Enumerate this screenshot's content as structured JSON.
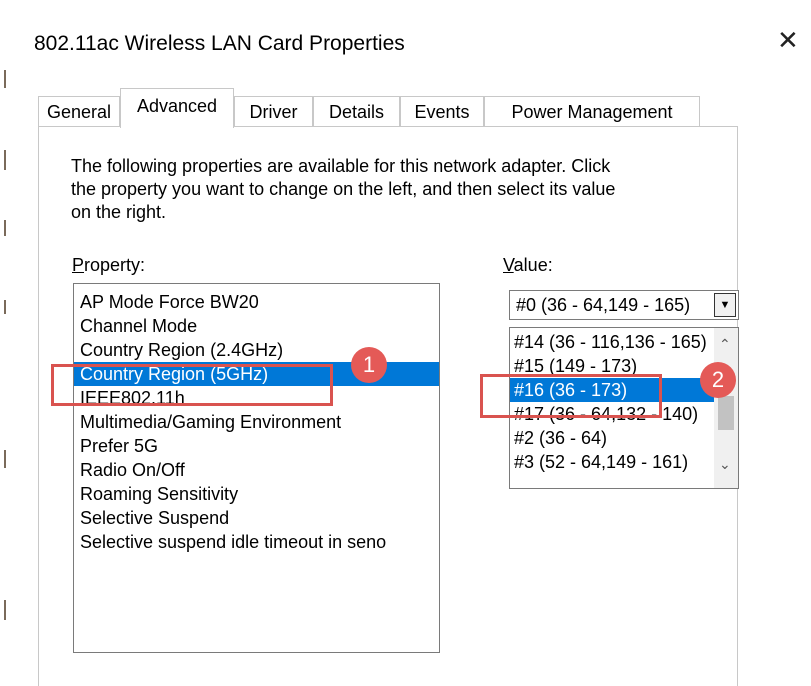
{
  "window": {
    "title": "802.11ac Wireless LAN Card Properties",
    "close_glyph": "✕"
  },
  "tabs": [
    {
      "label": "General",
      "active": false
    },
    {
      "label": "Advanced",
      "active": true
    },
    {
      "label": "Driver",
      "active": false
    },
    {
      "label": "Details",
      "active": false
    },
    {
      "label": "Events",
      "active": false
    },
    {
      "label": "Power Management",
      "active": false
    }
  ],
  "description": {
    "line1": "The following properties are available for this network adapter. Click",
    "line2": "the property you want to change on the left, and then select its value",
    "line3": "on the right."
  },
  "property": {
    "label_underlined": "P",
    "label_rest": "roperty:",
    "items": [
      "AP Mode Force BW20",
      "Channel Mode",
      "Country Region (2.4GHz)",
      "Country Region (5GHz)",
      "IEEE802.11h",
      "Multimedia/Gaming Environment",
      "Prefer 5G",
      "Radio On/Off",
      "Roaming Sensitivity",
      "Selective Suspend",
      "Selective suspend idle timeout in seno"
    ],
    "selected_index": 3
  },
  "value": {
    "label_underlined": "V",
    "label_rest": "alue:",
    "current": "#0 (36 - 64,149 - 165)",
    "dropdown_arrow": "▼",
    "options": [
      "#14 (36 - 116,136 - 165)",
      "#15 (149 - 173)",
      "#16 (36 - 173)",
      "#17 (36 - 64,132 - 140)",
      "#2 (36 - 64)",
      "#3 (52 - 64,149 - 161)"
    ],
    "selected_index": 2,
    "scroll_up_glyph": "⌃",
    "scroll_down_glyph": "⌄"
  },
  "annotations": {
    "badge1": "1",
    "badge2": "2",
    "color": "#e45a57"
  }
}
